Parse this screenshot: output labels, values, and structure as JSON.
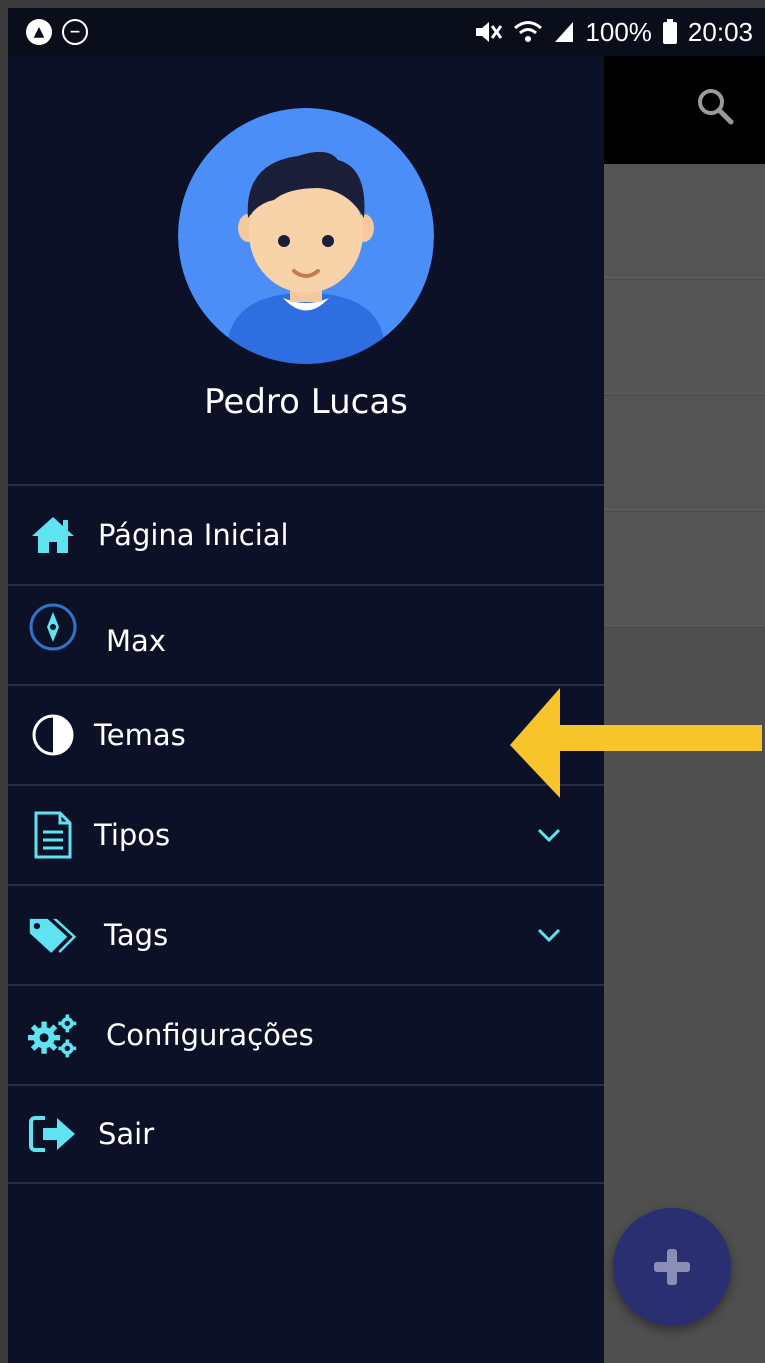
{
  "status_bar": {
    "battery": "100%",
    "time": "20:03"
  },
  "drawer": {
    "user_name": "Pedro Lucas",
    "items": [
      {
        "label": "Página Inicial",
        "icon": "home-icon",
        "has_chevron": false
      },
      {
        "label": "Max",
        "icon": "compass-icon",
        "has_chevron": false
      },
      {
        "label": "Temas",
        "icon": "contrast-icon",
        "has_chevron": false
      },
      {
        "label": "Tipos",
        "icon": "document-icon",
        "has_chevron": true
      },
      {
        "label": "Tags",
        "icon": "tags-icon",
        "has_chevron": true
      },
      {
        "label": "Configurações",
        "icon": "gears-icon",
        "has_chevron": false
      },
      {
        "label": "Sair",
        "icon": "logout-icon",
        "has_chevron": false
      }
    ]
  },
  "colors": {
    "drawer_bg": "#0d1128",
    "icon_accent": "#5fe3f0",
    "avatar_bg": "#4b8ef7",
    "annotation_arrow": "#f7c52b",
    "fab_bg": "#2a2f72"
  }
}
